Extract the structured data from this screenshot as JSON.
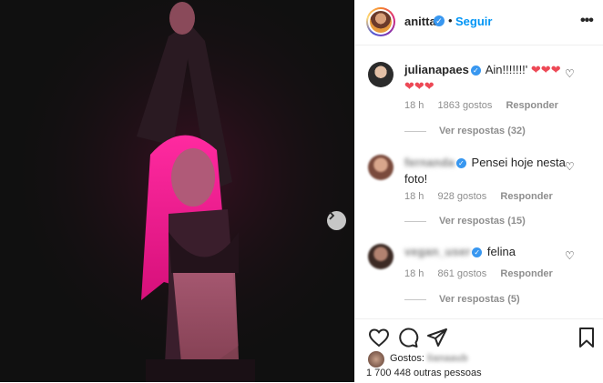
{
  "post": {
    "username": "anitta",
    "separator": "•",
    "follow_label": "Seguir",
    "more_label": "•••"
  },
  "comments": [
    {
      "username": "julianapaes",
      "verified": true,
      "text": "Ain!!!!!!!'",
      "hearts": "❤❤❤ ❤❤❤",
      "time": "18 h",
      "likes": "1863 gostos",
      "reply": "Responder",
      "replies": "Ver respostas (32)"
    },
    {
      "username": "fernanda",
      "verified": true,
      "text": "Pensei hoje nesta foto!",
      "time": "18 h",
      "likes": "928 gostos",
      "reply": "Responder",
      "replies": "Ver respostas (15)"
    },
    {
      "username": "vegan_user",
      "verified": true,
      "text": "felina",
      "time": "18 h",
      "likes": "861 gostos",
      "reply": "Responder",
      "replies": "Ver respostas (5)"
    }
  ],
  "likes": {
    "label": "Gostos:",
    "user": "lianaaub",
    "count": "1 700 448 outras pessoas"
  },
  "colors": {
    "accent": "#0095f6",
    "verified": "#3897f0",
    "heart": "#ed4956",
    "photo_bg": "#101010"
  }
}
